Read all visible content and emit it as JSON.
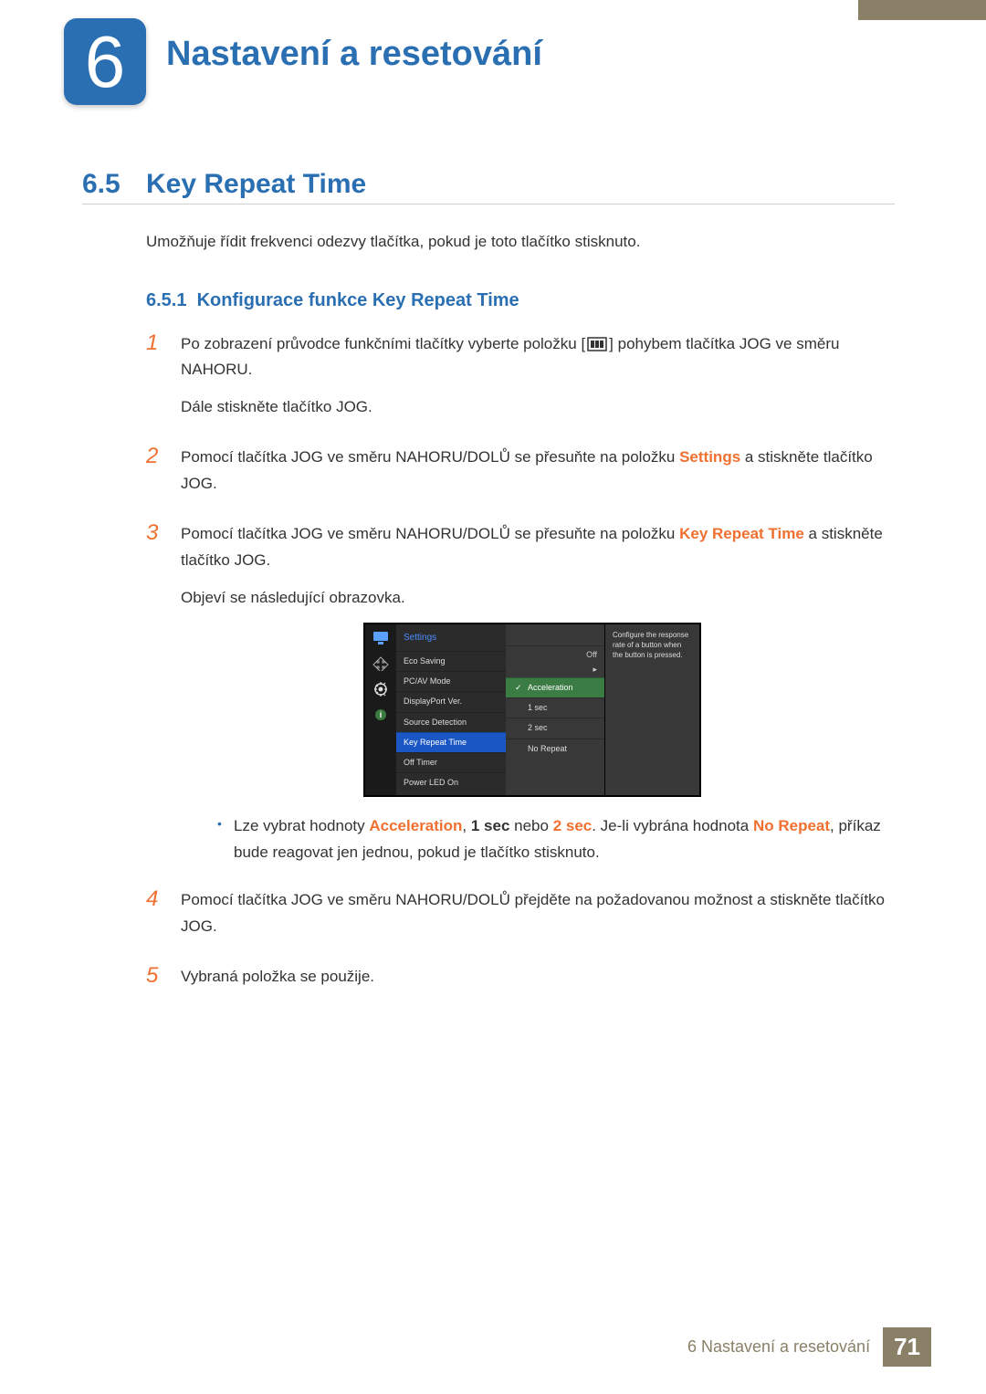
{
  "chapter": {
    "number": "6",
    "title": "Nastavení a resetování"
  },
  "section": {
    "number": "6.5",
    "title": "Key Repeat Time",
    "intro": "Umožňuje řídit frekvenci odezvy tlačítka, pokud je toto tlačítko stisknuto."
  },
  "subsection": {
    "number": "6.5.1",
    "title": "Konfigurace funkce Key Repeat Time"
  },
  "steps": {
    "s1_a": "Po zobrazení průvodce funkčními tlačítky vyberte položku [",
    "s1_b": "] pohybem tlačítka JOG ve směru NAHORU.",
    "s1_c": "Dále stiskněte tlačítko JOG.",
    "s2_a": "Pomocí tlačítka JOG ve směru NAHORU/DOLŮ se přesuňte na položku ",
    "s2_hl": "Settings",
    "s2_b": " a stiskněte tlačítko JOG.",
    "s3_a": "Pomocí tlačítka JOG ve směru NAHORU/DOLŮ se přesuňte na položku ",
    "s3_hl": "Key Repeat Time",
    "s3_b": " a stiskněte tlačítko JOG.",
    "s3_c": "Objeví se následující obrazovka.",
    "bullet_a": "Lze vybrat hodnoty ",
    "bullet_hl1": "Acceleration",
    "bullet_mid1": ", ",
    "bullet_hl2": "1 sec",
    "bullet_mid2": " nebo ",
    "bullet_hl3": "2 sec",
    "bullet_mid3": ". Je-li vybrána hodnota ",
    "bullet_hl4": "No Repeat",
    "bullet_b": ", příkaz bude reagovat jen jednou, pokud je tlačítko stisknuto.",
    "s4": "Pomocí tlačítka JOG ve směru NAHORU/DOLŮ přejděte na požadovanou možnost a stiskněte tlačítko JOG.",
    "s5": "Vybraná položka se použije.",
    "n1": "1",
    "n2": "2",
    "n3": "3",
    "n4": "4",
    "n5": "5"
  },
  "osd": {
    "header": "Settings",
    "items": {
      "i0": "Eco Saving",
      "i1": "PC/AV Mode",
      "i2": "DisplayPort Ver.",
      "i3": "Source Detection",
      "i4": "Key Repeat Time",
      "i5": "Off Timer",
      "i6": "Power LED On"
    },
    "off": "Off",
    "arrow": "▸",
    "sub": {
      "s0": "Acceleration",
      "s1": "1 sec",
      "s2": "2 sec",
      "s3": "No Repeat"
    },
    "info": "Configure the response rate of a button when the button is pressed."
  },
  "footer": {
    "text": "6 Nastavení a resetování",
    "page": "71"
  }
}
